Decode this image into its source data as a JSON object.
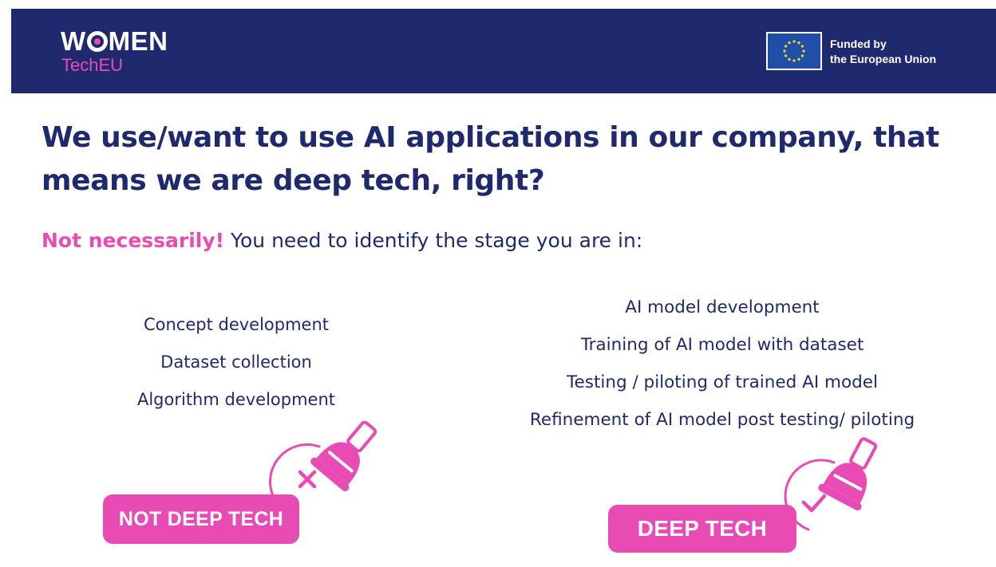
{
  "header": {
    "logo": {
      "line1_a": "W",
      "line1_b": "MEN",
      "line2": "TechEU"
    },
    "eu_funding": {
      "line1": "Funded by",
      "line2": "the European Union"
    }
  },
  "headline": {
    "line1": "We use/want to use AI applications in our company, that",
    "line2": "means we are deep tech, right?"
  },
  "subline": {
    "highlight": "Not necessarily!",
    "text": " You need to identify the stage you are in:"
  },
  "not_deep_tech": {
    "stages": [
      "Concept development",
      "Dataset collection",
      "Algorithm development"
    ],
    "badge": "NOT DEEP TECH"
  },
  "deep_tech": {
    "stages": [
      "AI model development",
      "Training of AI model with dataset",
      "Testing / piloting of trained AI model",
      "Refinement of AI model post testing/ piloting"
    ],
    "badge": "DEEP TECH"
  },
  "colors": {
    "navy": "#1f2a6e",
    "pink": "#e94bb4",
    "eu_blue": "#1f4fa8",
    "eu_star": "#ffd617"
  },
  "icons": {
    "header": [
      "eu-flag-icon"
    ],
    "left": [
      "plunger-icon",
      "cross-icon"
    ],
    "right": [
      "plunger-icon",
      "check-icon"
    ]
  }
}
